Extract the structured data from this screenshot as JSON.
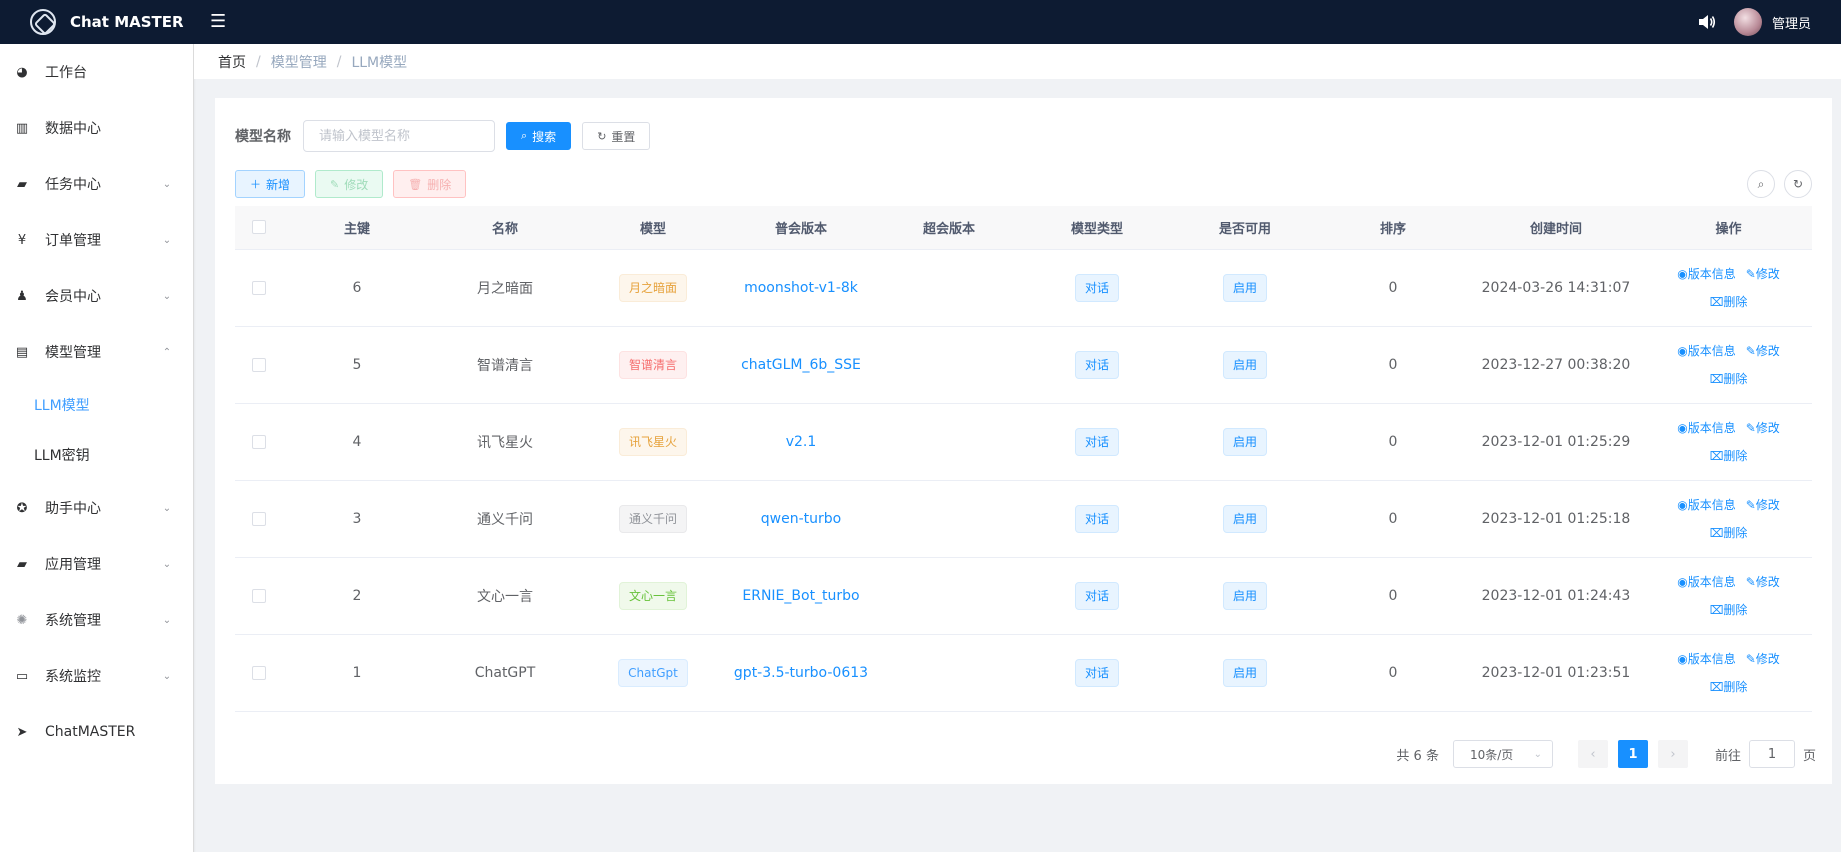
{
  "header": {
    "app_name": "Chat MASTER",
    "user_name": "管理员"
  },
  "sidebar": {
    "items": [
      {
        "label": "工作台"
      },
      {
        "label": "数据中心"
      },
      {
        "label": "任务中心"
      },
      {
        "label": "订单管理"
      },
      {
        "label": "会员中心"
      },
      {
        "label": "模型管理"
      },
      {
        "label": "助手中心"
      },
      {
        "label": "应用管理"
      },
      {
        "label": "系统管理"
      },
      {
        "label": "系统监控"
      },
      {
        "label": "ChatMASTER"
      }
    ],
    "sub_items": [
      {
        "label": "LLM模型"
      },
      {
        "label": "LLM密钥"
      }
    ]
  },
  "breadcrumb": [
    "首页",
    "模型管理",
    "LLM模型"
  ],
  "search": {
    "label": "模型名称",
    "placeholder": "请输入模型名称",
    "search_button": "搜索",
    "reset_button": "重置"
  },
  "toolbar": {
    "add": "新增",
    "edit": "修改",
    "delete": "删除"
  },
  "table": {
    "columns": [
      "主键",
      "名称",
      "模型",
      "普会版本",
      "超会版本",
      "模型类型",
      "是否可用",
      "排序",
      "创建时间",
      "操作"
    ],
    "rows": [
      {
        "id": "6",
        "name": "月之暗面",
        "model_tag": "月之暗面",
        "tag_color": "#e6a23c",
        "tag_bg": "#fdf6ec",
        "tag_border": "#faecd8",
        "normal_version": "moonshot-v1-8k",
        "super_version": "",
        "type": "对话",
        "enabled": "启用",
        "sort": "0",
        "created": "2024-03-26 14:31:07"
      },
      {
        "id": "5",
        "name": "智谱清言",
        "model_tag": "智谱清言",
        "tag_color": "#f56c6c",
        "tag_bg": "#fef0f0",
        "tag_border": "#fde2e2",
        "normal_version": "chatGLM_6b_SSE",
        "super_version": "",
        "type": "对话",
        "enabled": "启用",
        "sort": "0",
        "created": "2023-12-27 00:38:20"
      },
      {
        "id": "4",
        "name": "讯飞星火",
        "model_tag": "讯飞星火",
        "tag_color": "#e6a23c",
        "tag_bg": "#fdf6ec",
        "tag_border": "#faecd8",
        "normal_version": "v2.1",
        "super_version": "",
        "type": "对话",
        "enabled": "启用",
        "sort": "0",
        "created": "2023-12-01 01:25:29"
      },
      {
        "id": "3",
        "name": "通义千问",
        "model_tag": "通义千问",
        "tag_color": "#909399",
        "tag_bg": "#f4f4f5",
        "tag_border": "#e9e9eb",
        "normal_version": "qwen-turbo",
        "super_version": "",
        "type": "对话",
        "enabled": "启用",
        "sort": "0",
        "created": "2023-12-01 01:25:18"
      },
      {
        "id": "2",
        "name": "文心一言",
        "model_tag": "文心一言",
        "tag_color": "#67c23a",
        "tag_bg": "#f0f9eb",
        "tag_border": "#e1f3d8",
        "normal_version": "ERNIE_Bot_turbo",
        "super_version": "",
        "type": "对话",
        "enabled": "启用",
        "sort": "0",
        "created": "2023-12-01 01:24:43"
      },
      {
        "id": "1",
        "name": "ChatGPT",
        "model_tag": "ChatGpt",
        "tag_color": "#409eff",
        "tag_bg": "#ecf5ff",
        "tag_border": "#d9ecff",
        "normal_version": "gpt-3.5-turbo-0613",
        "super_version": "",
        "type": "对话",
        "enabled": "启用",
        "sort": "0",
        "created": "2023-12-01 01:23:51"
      }
    ],
    "ops": {
      "version_info": "版本信息",
      "edit": "修改",
      "delete": "删除"
    }
  },
  "pagination": {
    "total": "共 6 条",
    "page_size": "10条/页",
    "current_page": "1",
    "goto_prefix": "前往",
    "goto_value": "1",
    "goto_suffix": "页"
  }
}
